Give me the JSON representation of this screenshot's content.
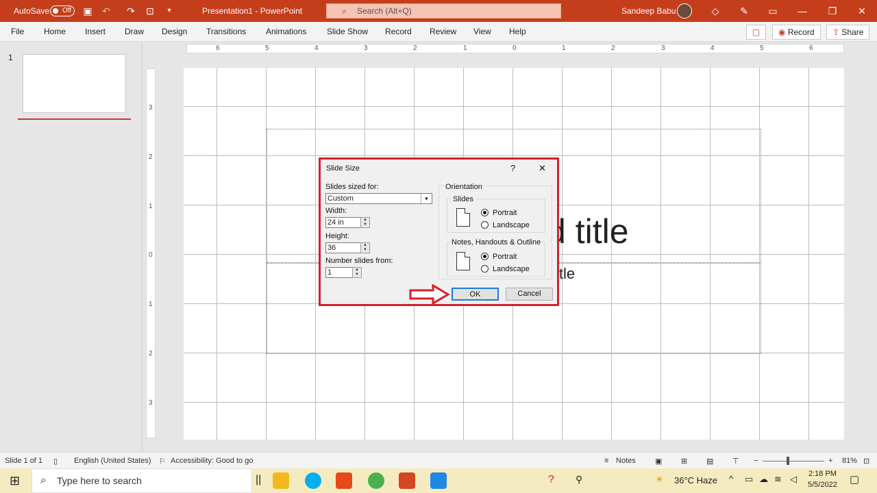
{
  "titlebar": {
    "autosave": "AutoSave",
    "autosave_state": "Off",
    "doc_title": "Presentation1  -  PowerPoint",
    "search_placeholder": "Search (Alt+Q)",
    "user": "Sandeep Babu"
  },
  "ribbon": {
    "tabs": [
      "File",
      "Home",
      "Insert",
      "Draw",
      "Design",
      "Transitions",
      "Animations",
      "Slide Show",
      "Record",
      "Review",
      "View",
      "Help"
    ],
    "record_btn": "Record",
    "share_btn": "Share"
  },
  "slides_pane": {
    "slide_number": "1"
  },
  "rulers": {
    "h": [
      "6",
      "5",
      "4",
      "3",
      "2",
      "1",
      "0",
      "1",
      "2",
      "3",
      "4",
      "5",
      "6"
    ],
    "v": [
      "3",
      "2",
      "1",
      "0",
      "1",
      "2",
      "3"
    ]
  },
  "slide": {
    "title_fragment": "d title",
    "subtitle_fragment": "itle"
  },
  "dialog": {
    "title": "Slide Size",
    "help": "?",
    "close": "✕",
    "sized_for_label": "Slides sized for:",
    "sized_for_value": "Custom",
    "width_label": "Width:",
    "width_value": "24 in",
    "height_label": "Height:",
    "height_value": "36",
    "number_from_label": "Number slides from:",
    "number_from_value": "1",
    "orientation_label": "Orientation",
    "slides_group": "Slides",
    "notes_group": "Notes, Handouts & Outline",
    "portrait": "Portrait",
    "landscape": "Landscape",
    "ok": "OK",
    "cancel": "Cancel"
  },
  "status": {
    "slide_of": "Slide 1 of 1",
    "language": "English (United States)",
    "accessibility": "Accessibility: Good to go",
    "notes": "Notes",
    "zoom": "81%"
  },
  "taskbar": {
    "search_placeholder": "Type here to search",
    "weather": "36°C  Haze",
    "time": "2:18 PM",
    "date": "5/5/2022"
  },
  "colors": {
    "accent": "#c43e1c",
    "highlight_border": "#d4202a",
    "taskbar": "#f4ecc0"
  }
}
